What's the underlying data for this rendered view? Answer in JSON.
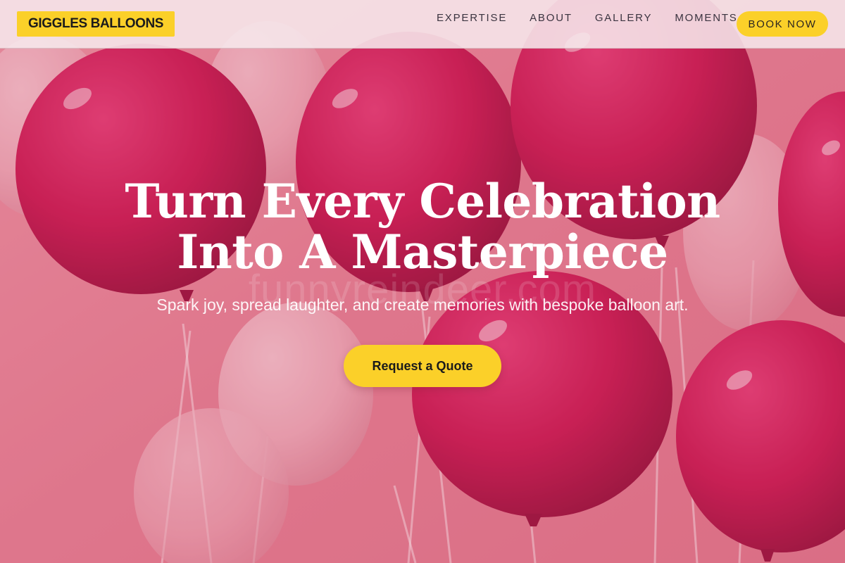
{
  "header": {
    "logo": "GIGGLES BALLOONS",
    "nav": [
      "EXPERTISE",
      "ABOUT",
      "GALLERY",
      "MOMENTS"
    ],
    "book_button": "BOOK NOW"
  },
  "hero": {
    "title_line1": "Turn Every Celebration",
    "title_line2": "Into A Masterpiece",
    "subtitle": "Spark joy, spread laughter, and create memories with bespoke balloon art.",
    "cta": "Request a Quote",
    "watermark": "funnyreindeer.com",
    "background": "pink-balloons-image"
  },
  "colors": {
    "accent": "#fbd029",
    "balloon": "#c8124f",
    "background": "#e98a9c"
  }
}
